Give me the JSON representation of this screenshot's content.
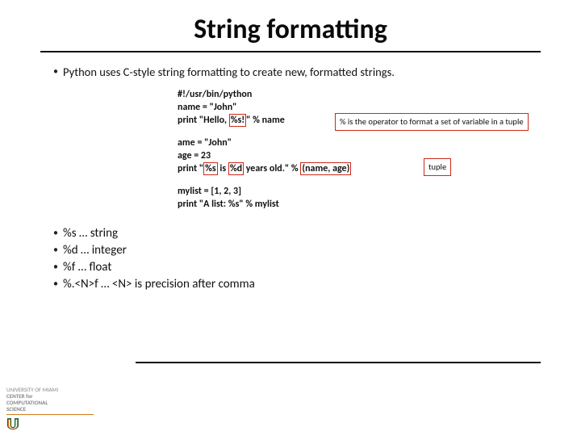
{
  "title": "String formatting",
  "intro": "Python uses C-style string formatting to create new, formatted strings.",
  "code": {
    "l1": "#!/usr/bin/python",
    "l2": "name = \"John\"",
    "l3a": "print \"Hello, ",
    "l3box": "%s!",
    "l3b": "\" % name",
    "callout1": "% is the operator to format a set of variable in a tuple",
    "l4": "ame = \"John\"",
    "l5": "age = 23",
    "l6a": "print \"",
    "l6box1": "%s",
    "l6b": " is ",
    "l6box2": "%d",
    "l6c": " years old.\" % ",
    "l6box3": "(name, age)",
    "callout2": "tuple",
    "l7": "mylist = [1, 2, 3]",
    "l8": "print \"A list: %s\" % mylist"
  },
  "formats": {
    "a": "%s … string",
    "b": "%d … integer",
    "c": "%f … float",
    "d": "%.<N>f … <N> is precision after comma"
  },
  "footer": {
    "l1": "UNIVERSITY OF MIAMI",
    "l2": "CENTER for",
    "l3": "COMPUTATIONAL",
    "l4": "SCIENCE"
  }
}
